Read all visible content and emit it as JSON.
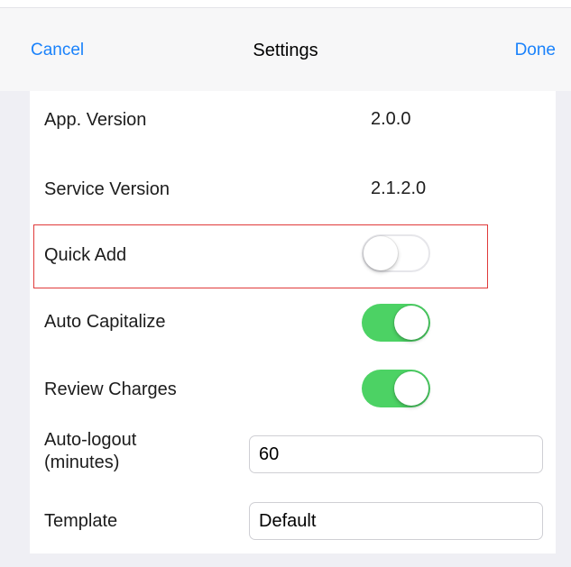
{
  "navbar": {
    "cancel_label": "Cancel",
    "title": "Settings",
    "done_label": "Done"
  },
  "settings": {
    "app_version": {
      "label": "App. Version",
      "value": "2.0.0"
    },
    "service_version": {
      "label": "Service Version",
      "value": "2.1.2.0"
    },
    "quick_add": {
      "label": "Quick Add",
      "enabled": false
    },
    "auto_capitalize": {
      "label": "Auto Capitalize",
      "enabled": true
    },
    "review_charges": {
      "label": "Review Charges",
      "enabled": true
    },
    "auto_logout": {
      "label_line1": "Auto-logout",
      "label_line2": "(minutes)",
      "value": "60"
    },
    "template": {
      "label": "Template",
      "value": "Default"
    }
  },
  "colors": {
    "accent": "#1a82fb",
    "toggle_on": "#4cd264",
    "highlight_border": "#e03a3a"
  }
}
